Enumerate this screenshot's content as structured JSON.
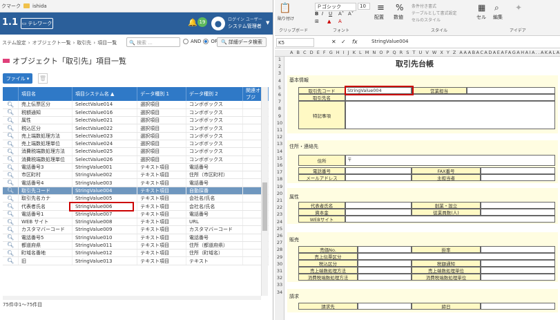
{
  "bookmark": {
    "prefix": "クマーク",
    "folder": "ishida"
  },
  "header": {
    "version": "1.1",
    "telework": "テレワーク",
    "notifications": "19",
    "user_line1": "ログイン ユーザー",
    "user_line2": "システム管理者"
  },
  "breadcrumb": [
    "ステム設定",
    "オブジェクト一覧",
    "取引先",
    "項目一覧"
  ],
  "search": {
    "placeholder": "検索 ..."
  },
  "filter": {
    "and": "AND",
    "or": "OR",
    "selected": "OR",
    "advanced": "詳細データ検索"
  },
  "page_title": "オブジェクト「取引先」項目一覧",
  "toolbar": {
    "file": "ファイル"
  },
  "table": {
    "columns": [
      "項目名",
      "項目システム名",
      "データ種別 1",
      "データ種別 2",
      "関連オブジ"
    ],
    "rows": [
      [
        "売上伝票区分",
        "SelectValue014",
        "選択項目",
        "コンボボックス"
      ],
      [
        "税額通知",
        "SelectValue016",
        "選択項目",
        "コンボボックス"
      ],
      [
        "属性",
        "SelectValue021",
        "選択項目",
        "コンボボックス"
      ],
      [
        "税込区分",
        "SelectValue022",
        "選択項目",
        "コンボボックス"
      ],
      [
        "売上端数処理方法",
        "SelectValue023",
        "選択項目",
        "コンボボックス"
      ],
      [
        "売上端数処理単位",
        "SelectValue024",
        "選択項目",
        "コンボボックス"
      ],
      [
        "消費税端数処理方法",
        "SelectValue025",
        "選択項目",
        "コンボボックス"
      ],
      [
        "消費税端数処理単位",
        "SelectValue026",
        "選択項目",
        "コンボボックス"
      ],
      [
        "電話番号3",
        "StringValue001",
        "テキスト項目",
        "電話番号"
      ],
      [
        "市区町村",
        "StringValue002",
        "テキスト項目",
        "住所（市区町村）"
      ],
      [
        "電話番号4",
        "StringValue003",
        "テキスト項目",
        "電話番号"
      ],
      [
        "取引先コード",
        "StringValue004",
        "テキスト項目",
        "自動採番"
      ],
      [
        "取引先名カナ",
        "StringValue005",
        "テキスト項目",
        "会社名/氏名"
      ],
      [
        "代表者氏名",
        "StringValue006",
        "テキスト項目",
        "会社名/氏名"
      ],
      [
        "電話番号1",
        "StringValue007",
        "テキスト項目",
        "電話番号"
      ],
      [
        "WEB サイト",
        "StringValue008",
        "テキスト項目",
        "URL"
      ],
      [
        "カスタマバーコード",
        "StringValue009",
        "テキスト項目",
        "カスタマバーコード"
      ],
      [
        "電話番号5",
        "StringValue010",
        "テキスト項目",
        "電話番号"
      ],
      [
        "都道府県",
        "StringValue011",
        "テキスト項目",
        "住所（都道府県）"
      ],
      [
        "町域名番地",
        "StringValue012",
        "テキスト項目",
        "住所（町域名）"
      ],
      [
        "旧",
        "StringValue013",
        "テキスト項目",
        "テキスト"
      ]
    ],
    "selected_row": 11,
    "footer": "75件中1～75件目"
  },
  "excel": {
    "ribbon": {
      "paste": "貼り付け",
      "clipboard": "クリップボード",
      "font": "フォント",
      "font_name": "Ｐゴシック",
      "font_size": "10",
      "align": "配置",
      "number": "数値",
      "style": "スタイル",
      "cond": "条件付き書式",
      "table_fmt": "テーブルとして書式設定",
      "cell_style": "セルのスタイル",
      "cell": "セル",
      "edit": "編集",
      "idea": "アイデア"
    },
    "namebox": "K5",
    "formula": "StringValue004",
    "columns": "A B C D E F G H I J K L M N O P Q R S T U V W X Y Z AAABACADAEAFAGAHAIA..AKALAMANAOAPAC",
    "sheet_title": "取引先台帳",
    "sections": {
      "basic": "基本情報",
      "address": "住所・連絡先",
      "attr": "属性",
      "sales": "販売",
      "billing": "請求"
    },
    "labels": {
      "code": "取引先コード",
      "code_value": "StringValue004",
      "sales_rep": "営業担当",
      "name": "取引先名",
      "notes": "特記事項",
      "addr": "住所",
      "postal": "〒",
      "tel": "電話番号",
      "fax": "FAX番号",
      "mail": "メールアドレス",
      "contact": "主担当者",
      "rep": "代表者氏名",
      "founded": "創業・設立",
      "capital": "資本金",
      "employees": "従業員数(人)",
      "web": "WEBサイト",
      "sales_no": "売価No.",
      "rate": "掛率",
      "slip": "売上伝票区分",
      "taxinc": "税込区分",
      "taxnotice": "税額通知",
      "round_m": "売上端数処理方法",
      "round_u": "売上端数処理単位",
      "ctax_m": "消費税端数処理方法",
      "ctax_u": "消費税端数処理単位",
      "bill_to": "請求先",
      "close_day": "締日"
    }
  },
  "colors": {
    "header": "#2b5f9a",
    "grid_header": "#2f79c7",
    "selected": "#6f97bf",
    "highlight": "#cc0000",
    "sheet": "#fffde1"
  }
}
